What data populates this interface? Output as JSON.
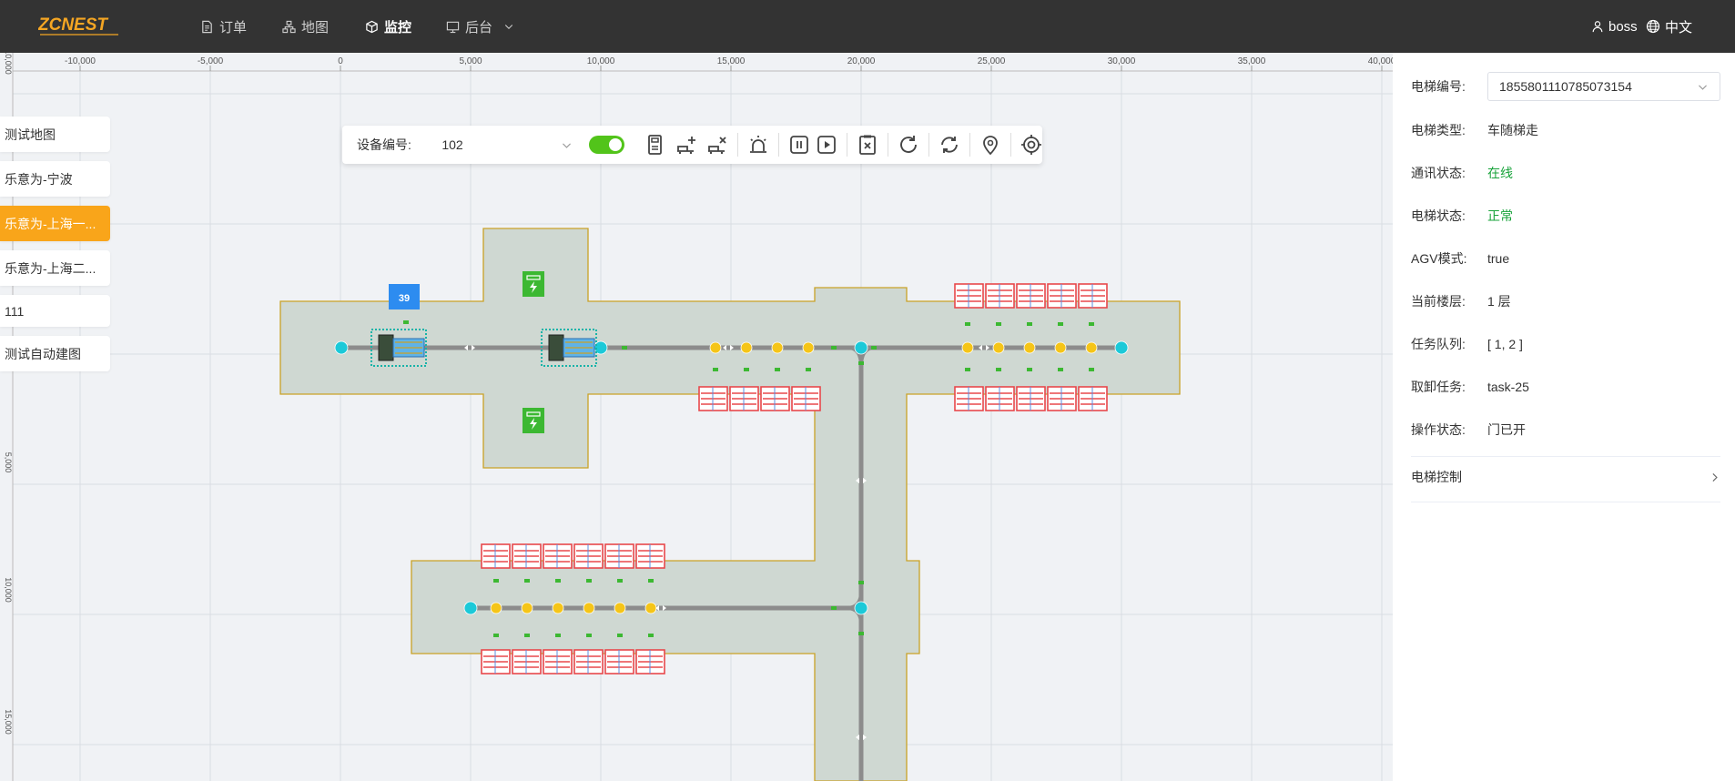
{
  "header": {
    "logo_text": "ZCNEST",
    "nav": [
      {
        "label": "订单",
        "icon": "document-icon"
      },
      {
        "label": "地图",
        "icon": "sitemap-icon"
      },
      {
        "label": "监控",
        "icon": "cube-icon"
      },
      {
        "label": "后台",
        "icon": "monitor-icon"
      }
    ],
    "user": "boss",
    "language": "中文"
  },
  "left_menu": [
    {
      "label": "测试地图"
    },
    {
      "label": "乐意为-宁波"
    },
    {
      "label": "乐意为-上海一..."
    },
    {
      "label": "乐意为-上海二..."
    },
    {
      "label": "111"
    },
    {
      "label": "测试自动建图"
    }
  ],
  "toolbar": {
    "device_label": "设备编号:",
    "device_value": "102",
    "auto_switch_on": true,
    "icons": [
      "charge-station-icon",
      "add-agv-icon",
      "remove-agv-icon",
      "alarm-icon",
      "pause-icon",
      "play-icon",
      "clear-task-icon",
      "refresh-icon",
      "sync-icon",
      "location-pin-icon",
      "target-icon"
    ]
  },
  "ruler": {
    "x_ticks": [
      "-10,000",
      "-5,000",
      "0",
      "5,000",
      "10,000",
      "15,000",
      "20,000",
      "25,000",
      "30,000",
      "35,000",
      "40,000"
    ],
    "y_ticks": [
      "10,000",
      "5,000",
      "10,000",
      "15,000"
    ]
  },
  "map": {
    "robot_badge": "39"
  },
  "elevator_panel": {
    "id_label": "电梯编号:",
    "id_value": "1855801110785073154",
    "type_label": "电梯类型:",
    "type_value": "车随梯走",
    "comm_label": "通讯状态:",
    "comm_value": "在线",
    "status_label": "电梯状态:",
    "status_value": "正常",
    "agv_label": "AGV模式:",
    "agv_value": "true",
    "floor_label": "当前楼层:",
    "floor_value": "1 层",
    "queue_label": "任务队列:",
    "queue_value": "[ 1, 2 ]",
    "task_label": "取卸任务:",
    "task_value": "task-25",
    "op_label": "操作状态:",
    "op_value": "门已开",
    "control_label": "电梯控制"
  },
  "colors": {
    "header_bg": "#333333",
    "active_menu": "#f9a51a",
    "online_green": "#19a33b",
    "zone_fill": "#cfd8d2",
    "zone_border": "#c9a227",
    "shelf_red": "#e8484b",
    "node_yellow": "#f5c518",
    "node_cyan": "#1cc9d8",
    "charger_green": "#3cb832",
    "badge_blue": "#2d8cf0"
  }
}
